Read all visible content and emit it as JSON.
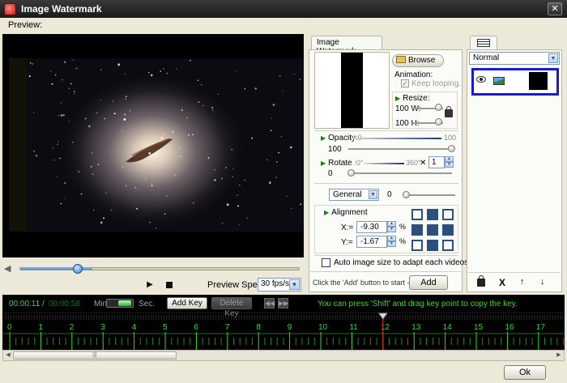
{
  "window": {
    "title": "Image Watermark",
    "close_label": "✕"
  },
  "preview": {
    "label": "Preview:"
  },
  "playback": {
    "volume_icon": "◀",
    "play_icon": "▶",
    "speed_label": "Preview Speed:",
    "speed_value": "30 fps/s",
    "seek_progress": 0.26
  },
  "watermark_tab": {
    "label": "Image Watermark"
  },
  "image": {
    "browse_label": "Browse",
    "animation_label": "Animation:",
    "keep_looping_label": "Keep looping.",
    "keep_looping_checked": true,
    "resize_label": "Resize:",
    "width_value": "100",
    "width_label": "W:",
    "height_value": "100",
    "height_label": "H:"
  },
  "opacity": {
    "label": "Opacity",
    "min": ":0",
    "max": "100",
    "value": "100"
  },
  "rotate": {
    "label": "Rotate",
    "min": ":0°",
    "max": "360°",
    "times": "✕",
    "multiplier": "1",
    "value": "0"
  },
  "effect": {
    "selected": "General",
    "value": "0"
  },
  "alignment": {
    "label": "Alignment",
    "x_label": "X:=",
    "x_value": "-9.30",
    "y_label": "Y:=",
    "y_value": "-1.67",
    "pct": "%"
  },
  "auto_size": {
    "label": "Auto image size to adapt each videos.",
    "checked": false
  },
  "add": {
    "hint": "Click the 'Add' button to start ->",
    "button": "Add"
  },
  "layers": {
    "blend_mode": "Normal",
    "delete": "X",
    "up": "↑",
    "down": "↓"
  },
  "timeline": {
    "current_time": "00:00:11",
    "separator": "/",
    "total_time": "00:00:58",
    "min_label": "Min.",
    "sec_label": "Sec.",
    "add_key": "Add Key",
    "delete_key": "Delete Key",
    "tip": "You can press 'Shift' and drag key point to copy the key.",
    "ticks": [
      "0",
      "1",
      "2",
      "3",
      "4",
      "5",
      "6",
      "7",
      "8",
      "9",
      "10",
      "11",
      "12",
      "13",
      "14",
      "15",
      "16",
      "17"
    ],
    "playhead": 12
  },
  "scroll": {
    "thumb_grip": "|||",
    "left": "◀",
    "right": "▶"
  },
  "ok_label": "Ok",
  "colors": {
    "accent_green": "#2fdc2f",
    "selection_blue": "#1a1ad6",
    "playhead_red": "#ff2020"
  }
}
